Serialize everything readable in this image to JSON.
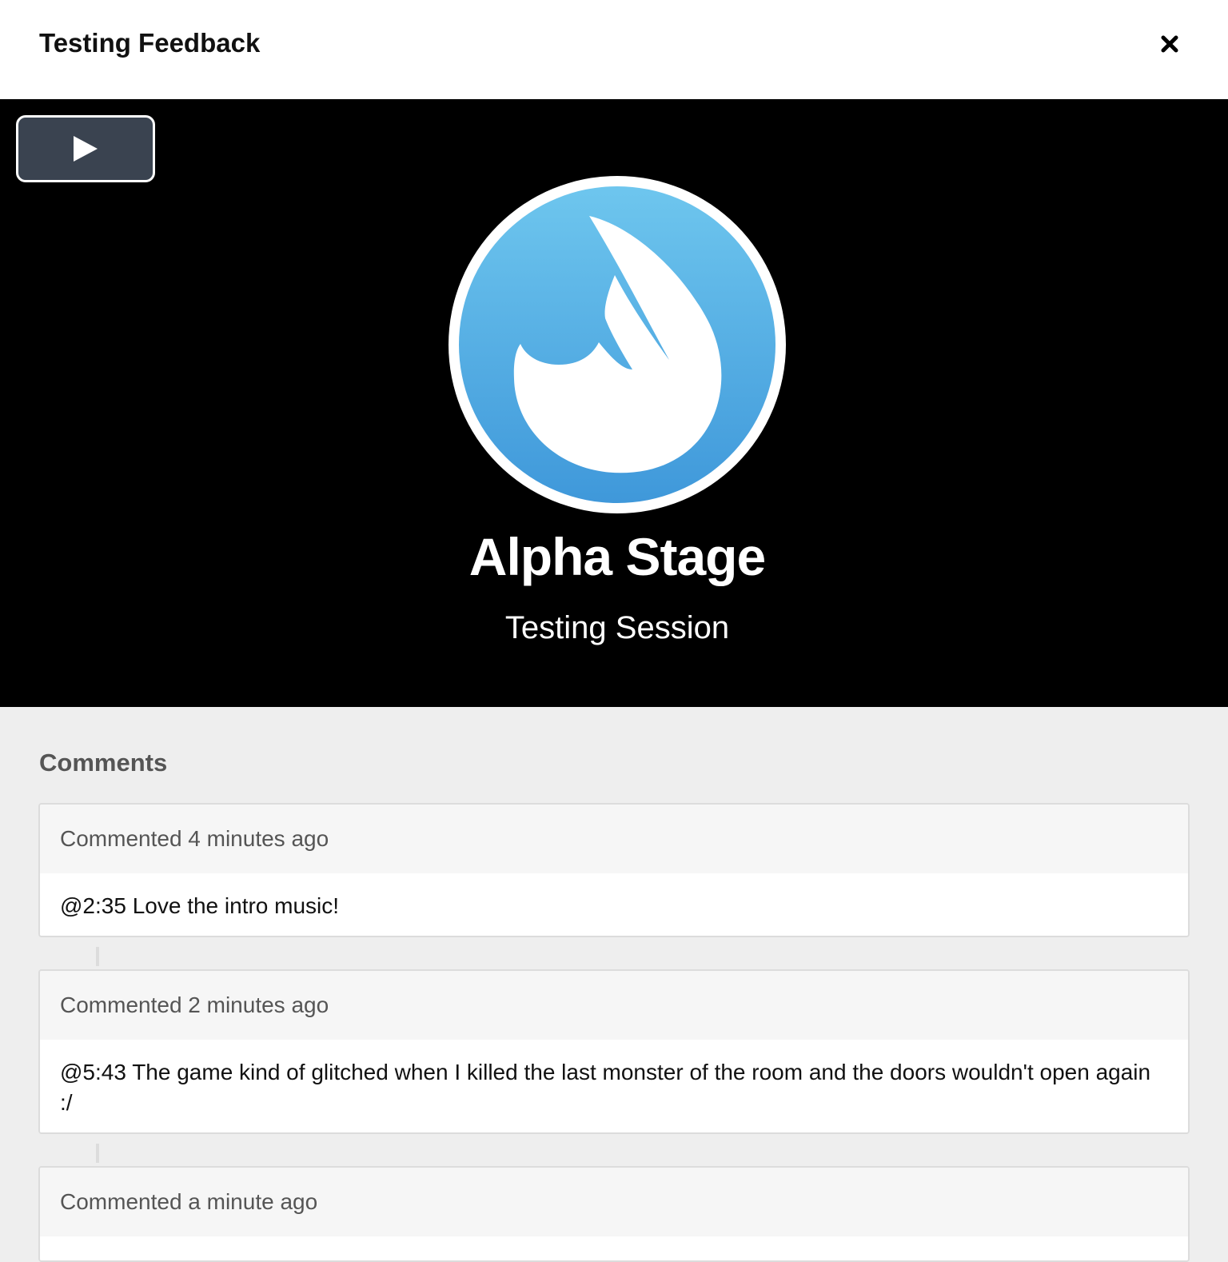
{
  "modal": {
    "title": "Testing Feedback",
    "close_icon": "close-icon"
  },
  "video": {
    "play_icon": "play-icon",
    "brand_name": "Alpha Stage",
    "brand_sub": "Testing Session",
    "colors": {
      "background": "#000000",
      "logo_blue_top": "#6ec6ee",
      "logo_blue_bottom": "#3f98da"
    }
  },
  "comments": {
    "title": "Comments",
    "items": [
      {
        "meta": "Commented 4 minutes ago",
        "text": "@2:35 Love the intro music!"
      },
      {
        "meta": "Commented 2 minutes ago",
        "text": "@5:43 The game kind of glitched when I killed the last monster of the room and the doors wouldn't open again :/"
      },
      {
        "meta": "Commented a minute ago",
        "text": ""
      }
    ]
  }
}
